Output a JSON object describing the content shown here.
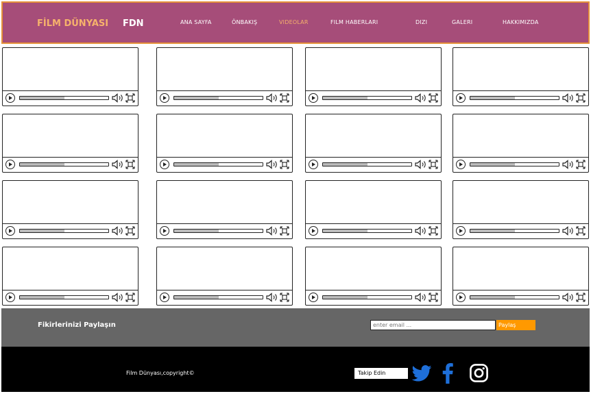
{
  "header": {
    "brand_name": "FİLM DÜNYASI",
    "brand_short": "FDN",
    "nav": [
      {
        "label": "ANA SAYFA"
      },
      {
        "label": "ÖNBAKIŞ"
      },
      {
        "label": "VIDEOLAR"
      },
      {
        "label": "FILM HABERLARI"
      },
      {
        "label": "DIZI"
      },
      {
        "label": "GALERI"
      },
      {
        "label": "HAKKIMIZDA"
      }
    ],
    "active_nav": "VIDEOLAR"
  },
  "videos": {
    "rows": 4,
    "columns": 4,
    "progress_fraction": 0.5
  },
  "share": {
    "label": "Fikirlerinizi Paylaşın",
    "email_placeholder": "enter email ...",
    "button_label": "Paylaş"
  },
  "footer": {
    "copyright": "Film Dünyası,copyright©",
    "follow_label": "Takip Edin",
    "social_icons": [
      "twitter-icon",
      "facebook-icon",
      "instagram-icon"
    ]
  },
  "colors": {
    "header_bg": "#a64d79",
    "header_border": "#e69138",
    "accent": "#f6b26b",
    "share_button": "#ff9900",
    "share_band": "#666666",
    "footer_bg": "#000000",
    "social_blue": "#1e6fd9"
  }
}
